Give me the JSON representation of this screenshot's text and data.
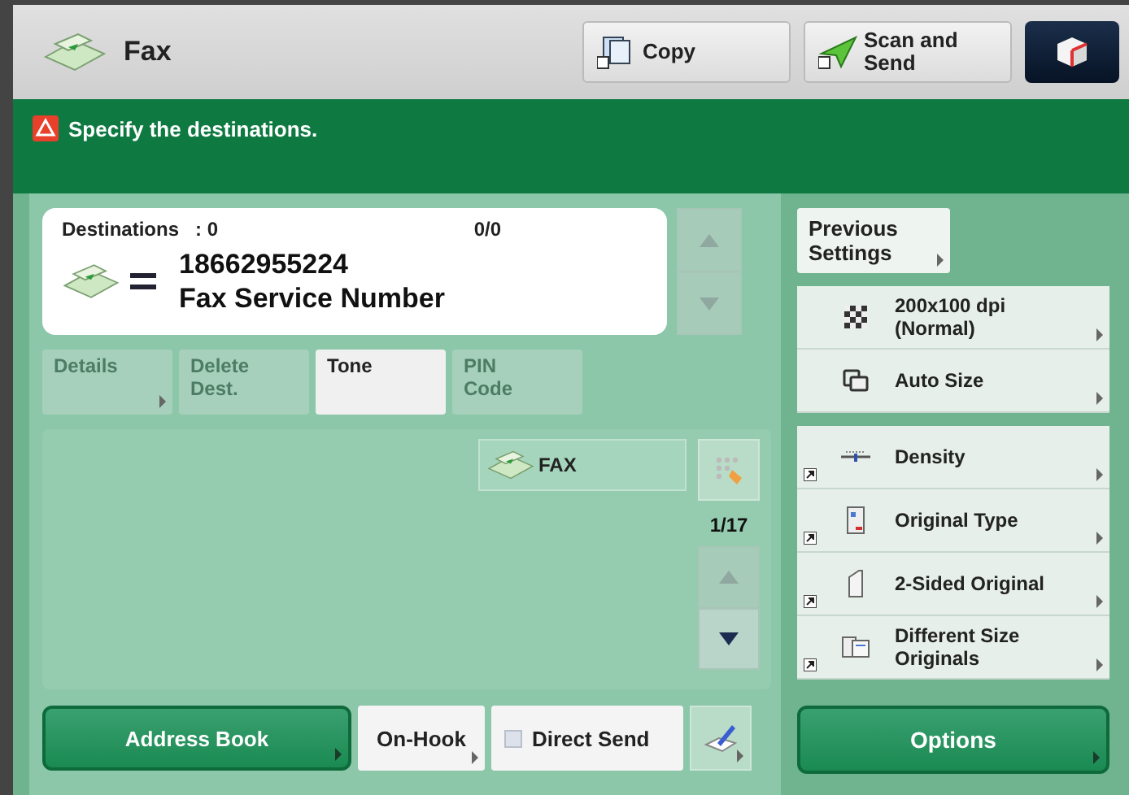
{
  "header": {
    "title": "Fax",
    "modes": [
      {
        "kind": "copy",
        "label": "Copy"
      },
      {
        "kind": "scan",
        "label": "Scan and Send"
      }
    ]
  },
  "message": "Specify the destinations.",
  "destinations": {
    "label": "Destinations",
    "count": ": 0",
    "page": "0/0",
    "number": "18662955224",
    "name": "Fax Service Number",
    "scroll": [
      {
        "kind": "up",
        "disabled": true
      },
      {
        "kind": "down",
        "disabled": true
      }
    ]
  },
  "dest_buttons": [
    {
      "label": "Details",
      "disabled": true,
      "arrow": true
    },
    {
      "label": "Delete Dest.",
      "disabled": true,
      "arrow": false
    },
    {
      "label": "Tone",
      "disabled": false,
      "arrow": false
    },
    {
      "label": "PIN Code",
      "disabled": true,
      "arrow": false
    }
  ],
  "address_tab": "FAX",
  "page_count": "1/17",
  "list_scroll": [
    {
      "kind": "up",
      "disabled": true
    },
    {
      "kind": "down",
      "disabled": false
    }
  ],
  "bottom": {
    "address_book": "Address Book",
    "on_hook": "On-Hook",
    "direct_send": {
      "label": "Direct Send",
      "checked": false
    }
  },
  "settings": {
    "previous": "Previous Settings",
    "groups": [
      [
        {
          "kind": "resolution",
          "label": "200x100 dpi (Normal)",
          "shortcut": false
        },
        {
          "kind": "size",
          "label": "Auto Size",
          "shortcut": false
        }
      ],
      [
        {
          "kind": "density",
          "label": "Density",
          "shortcut": true
        },
        {
          "kind": "type",
          "label": "Original Type",
          "shortcut": true
        },
        {
          "kind": "duplex",
          "label": "2-Sided Original",
          "shortcut": true
        },
        {
          "kind": "mixed",
          "label": "Different Size Originals",
          "shortcut": true
        }
      ]
    ],
    "options": "Options"
  }
}
